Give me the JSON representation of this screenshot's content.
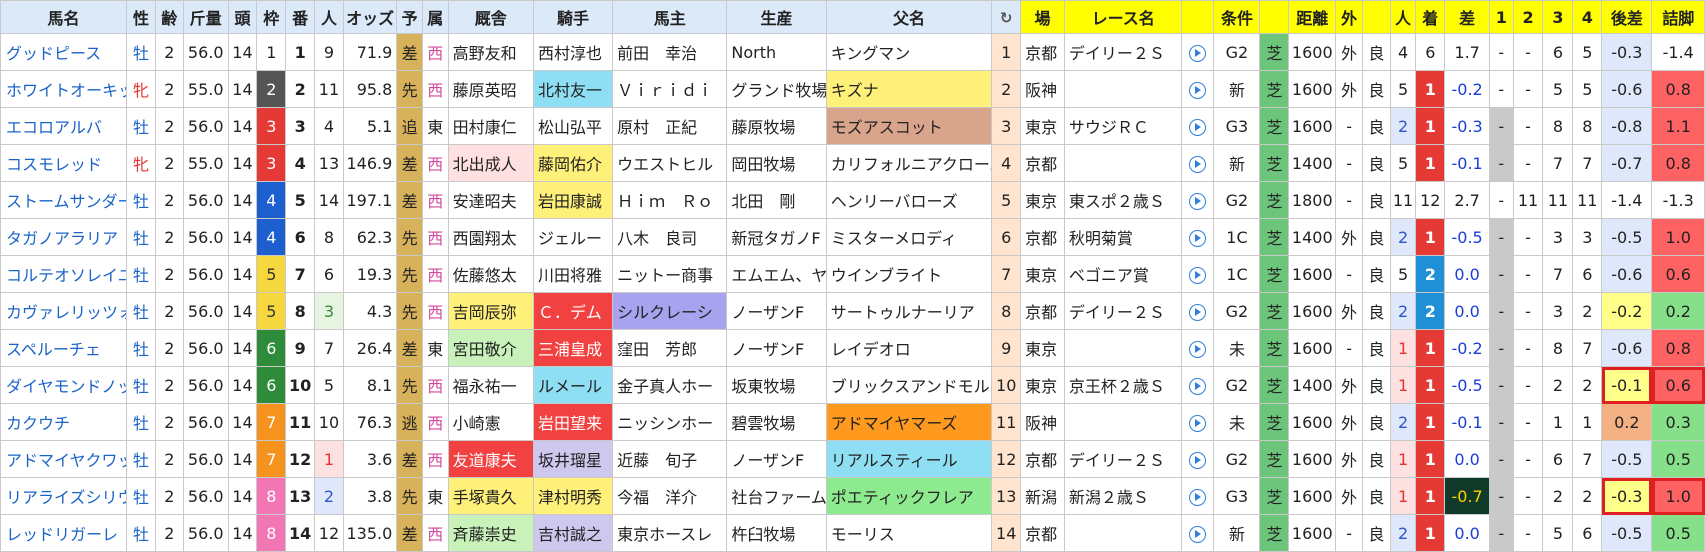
{
  "headers": [
    "馬名",
    "性",
    "齢",
    "斤量",
    "頭",
    "枠",
    "番",
    "人",
    "オッズ",
    "予",
    "属",
    "厩舎",
    "騎手",
    "馬主",
    "生産",
    "父名",
    "",
    "場",
    "レース名",
    "",
    "条件",
    "",
    "距離",
    "外",
    "",
    "人",
    "着",
    "差",
    "1",
    "2",
    "3",
    "4",
    "後差",
    "詰脚"
  ],
  "rows": [
    [
      "グッドピース",
      "牡",
      "2",
      "56.0",
      "14",
      "1",
      "1",
      "9",
      "71.9",
      "差",
      "西",
      "高野友和",
      "西村淳也",
      "前田　幸治",
      "North",
      "キングマン",
      "1",
      "京都",
      "デイリー２Ｓ",
      "",
      "G2",
      "芝",
      "1600",
      "外",
      "良",
      "4",
      "6",
      "1.7",
      "-",
      "-",
      "6",
      "5",
      "-0.3",
      "-1.4"
    ],
    [
      "ホワイトオーキッド",
      "牝",
      "2",
      "55.0",
      "14",
      "2",
      "2",
      "11",
      "95.8",
      "先",
      "西",
      "藤原英昭",
      "北村友一",
      "Ｖｉｒｉｄｉ",
      "グランド牧場",
      "キズナ",
      "2",
      "阪神",
      "",
      "",
      "新",
      "芝",
      "1600",
      "外",
      "良",
      "5",
      "1",
      "-0.2",
      "-",
      "-",
      "5",
      "5",
      "-0.6",
      "0.8"
    ],
    [
      "エコロアルバ",
      "牡",
      "2",
      "56.0",
      "14",
      "3",
      "3",
      "4",
      "5.1",
      "追",
      "東",
      "田村康仁",
      "松山弘平",
      "原村　正紀",
      "藤原牧場",
      "モズアスコット",
      "3",
      "東京",
      "サウジＲＣ",
      "",
      "G3",
      "芝",
      "1600",
      "-",
      "良",
      "2",
      "1",
      "-0.3",
      "-",
      "-",
      "8",
      "8",
      "-0.8",
      "1.1"
    ],
    [
      "コスモレッド",
      "牝",
      "2",
      "55.0",
      "14",
      "3",
      "4",
      "13",
      "146.9",
      "差",
      "西",
      "北出成人",
      "藤岡佑介",
      "ウエストヒル",
      "岡田牧場",
      "カリフォルニアクローム",
      "4",
      "京都",
      "",
      "",
      "新",
      "芝",
      "1400",
      "-",
      "良",
      "5",
      "1",
      "-0.1",
      "-",
      "-",
      "7",
      "7",
      "-0.7",
      "0.8"
    ],
    [
      "ストームサンダー",
      "牡",
      "2",
      "56.0",
      "14",
      "4",
      "5",
      "14",
      "197.1",
      "差",
      "西",
      "安達昭夫",
      "岩田康誠",
      "Ｈｉｍ　Ｒｏ",
      "北田　剛",
      "ヘンリーバローズ",
      "5",
      "東京",
      "東スポ２歳Ｓ",
      "",
      "G2",
      "芝",
      "1800",
      "-",
      "良",
      "11",
      "12",
      "2.7",
      "-",
      "11",
      "11",
      "11",
      "-1.4",
      "-1.3"
    ],
    [
      "タガノアラリア",
      "牡",
      "2",
      "56.0",
      "14",
      "4",
      "6",
      "8",
      "62.3",
      "先",
      "西",
      "西園翔太",
      "ジェルー",
      "八木　良司",
      "新冠タガノF",
      "ミスターメロディ",
      "6",
      "京都",
      "秋明菊賞",
      "",
      "1C",
      "芝",
      "1400",
      "外",
      "良",
      "2",
      "1",
      "-0.5",
      "-",
      "-",
      "3",
      "3",
      "-0.5",
      "1.0"
    ],
    [
      "コルテオソレイユ",
      "牡",
      "2",
      "56.0",
      "14",
      "5",
      "7",
      "6",
      "19.3",
      "先",
      "西",
      "佐藤悠太",
      "川田将雅",
      "ニットー商事",
      "エムエム、ヤ",
      "ウインブライト",
      "7",
      "東京",
      "ベゴニア賞",
      "",
      "1C",
      "芝",
      "1600",
      "-",
      "良",
      "5",
      "2",
      "0.0",
      "-",
      "-",
      "7",
      "6",
      "-0.6",
      "0.6"
    ],
    [
      "カヴァレリッツォ",
      "牡",
      "2",
      "56.0",
      "14",
      "5",
      "8",
      "3",
      "4.3",
      "先",
      "西",
      "吉岡辰弥",
      "Ｃ．デム",
      "シルクレーシ",
      "ノーザンF",
      "サートゥルナーリア",
      "8",
      "京都",
      "デイリー２Ｓ",
      "",
      "G2",
      "芝",
      "1600",
      "外",
      "良",
      "2",
      "2",
      "0.0",
      "-",
      "-",
      "3",
      "2",
      "-0.2",
      "0.2"
    ],
    [
      "スペルーチェ",
      "牡",
      "2",
      "56.0",
      "14",
      "6",
      "9",
      "7",
      "26.4",
      "差",
      "東",
      "宮田敬介",
      "三浦皇成",
      "窪田　芳郎",
      "ノーザンF",
      "レイデオロ",
      "9",
      "東京",
      "",
      "",
      "未",
      "芝",
      "1600",
      "-",
      "良",
      "1",
      "1",
      "-0.2",
      "-",
      "-",
      "8",
      "7",
      "-0.6",
      "0.8"
    ],
    [
      "ダイヤモンドノット",
      "牡",
      "2",
      "56.0",
      "14",
      "6",
      "10",
      "5",
      "8.1",
      "先",
      "西",
      "福永祐一",
      "ルメール",
      "金子真人ホー",
      "坂東牧場",
      "ブリックスアンドモルタル",
      "10",
      "東京",
      "京王杯２歳Ｓ",
      "",
      "G2",
      "芝",
      "1400",
      "外",
      "良",
      "1",
      "1",
      "-0.5",
      "-",
      "-",
      "2",
      "2",
      "-0.1",
      "0.6"
    ],
    [
      "カクウチ",
      "牡",
      "2",
      "56.0",
      "14",
      "7",
      "11",
      "10",
      "76.3",
      "逃",
      "西",
      "小崎憲",
      "岩田望来",
      "ニッシンホー",
      "碧雲牧場",
      "アドマイヤマーズ",
      "11",
      "阪神",
      "",
      "",
      "未",
      "芝",
      "1600",
      "外",
      "良",
      "2",
      "1",
      "-0.1",
      "-",
      "-",
      "1",
      "1",
      "0.2",
      "0.3"
    ],
    [
      "アドマイヤクワッズ",
      "牡",
      "2",
      "56.0",
      "14",
      "7",
      "12",
      "1",
      "3.6",
      "差",
      "西",
      "友道康夫",
      "坂井瑠星",
      "近藤　旬子",
      "ノーザンF",
      "リアルスティール",
      "12",
      "京都",
      "デイリー２Ｓ",
      "",
      "G2",
      "芝",
      "1600",
      "外",
      "良",
      "1",
      "1",
      "0.0",
      "-",
      "-",
      "6",
      "7",
      "-0.5",
      "0.5"
    ],
    [
      "リアライズシリウス",
      "牡",
      "2",
      "56.0",
      "14",
      "8",
      "13",
      "2",
      "3.8",
      "先",
      "東",
      "手塚貴久",
      "津村明秀",
      "今福　洋介",
      "社台ファーム",
      "ポエティックフレア",
      "13",
      "新潟",
      "新潟２歳Ｓ",
      "",
      "G3",
      "芝",
      "1600",
      "外",
      "良",
      "1",
      "1",
      "-0.7",
      "-",
      "-",
      "2",
      "2",
      "-0.3",
      "1.0"
    ],
    [
      "レッドリガーレ",
      "牡",
      "2",
      "56.0",
      "14",
      "8",
      "14",
      "12",
      "135.0",
      "差",
      "西",
      "斉藤崇史",
      "吉村誠之",
      "東京ホースレ",
      "杵臼牧場",
      "モーリス",
      "14",
      "京都",
      "",
      "",
      "新",
      "芝",
      "1600",
      "-",
      "良",
      "2",
      "1",
      "0.0",
      "-",
      "-",
      "5",
      "6",
      "-0.5",
      "0.5"
    ]
  ],
  "colors": {
    "header": "#dce9f8",
    "header_yellow": "#ffff00",
    "link": "#1a63c8",
    "female": "#e3342f"
  }
}
